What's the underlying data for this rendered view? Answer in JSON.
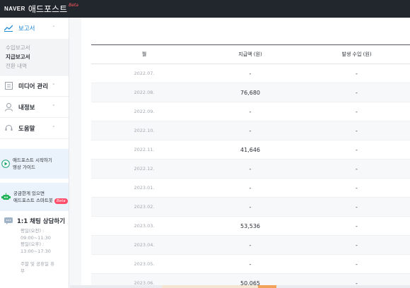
{
  "topbar": {
    "brand": "NAVER",
    "title": "애드포스트",
    "beta": "Beta"
  },
  "sidebar": {
    "report": {
      "label": "보고서",
      "chev": "˄"
    },
    "submenu": [
      "수입보고서",
      "지급보고서",
      "전환 내역"
    ],
    "current_submenu": "지급보고서",
    "items": [
      {
        "label": "미디어 관리",
        "chev": "˅"
      },
      {
        "label": "내정보",
        "chev": "˅"
      },
      {
        "label": "도움말",
        "chev": "˅"
      }
    ],
    "promo1": {
      "line1": "애드포스트 시작하기",
      "line2": "영상 가이드"
    },
    "promo2": {
      "line1": "궁금한게 있으면",
      "line2": "애드포스트 스마트봇",
      "beta": "Beta"
    },
    "chat": {
      "title": "1:1 채팅 상담하기",
      "lines": [
        "평일(오전) :",
        "09:00~11:30",
        "평일(오후) :",
        "13:00~17:30",
        "",
        "주말 및 공휴일 휴",
        "무"
      ]
    }
  },
  "table": {
    "headers": [
      "월",
      "지급액 (원)",
      "발생 수입 (원)"
    ],
    "rows": [
      {
        "month": "2022.07.",
        "amount": "-",
        "revenue": "-"
      },
      {
        "month": "2022.08.",
        "amount": "76,680",
        "revenue": "-"
      },
      {
        "month": "2022.09.",
        "amount": "-",
        "revenue": "-"
      },
      {
        "month": "2022.10.",
        "amount": "-",
        "revenue": "-"
      },
      {
        "month": "2022.11.",
        "amount": "41,646",
        "revenue": "-"
      },
      {
        "month": "2022.12.",
        "amount": "-",
        "revenue": "-"
      },
      {
        "month": "2023.01.",
        "amount": "-",
        "revenue": "-"
      },
      {
        "month": "2023.02.",
        "amount": "-",
        "revenue": "-"
      },
      {
        "month": "2023.03.",
        "amount": "53,536",
        "revenue": "-"
      },
      {
        "month": "2023.04.",
        "amount": "-",
        "revenue": "-"
      },
      {
        "month": "2023.05.",
        "amount": "-",
        "revenue": "-"
      },
      {
        "month": "2023.06.",
        "amount": "50,065",
        "revenue": "-"
      }
    ]
  },
  "colors": {
    "accent": "#1f8ad6",
    "topbar": "#22272e",
    "beta": "#ff4d6a"
  }
}
